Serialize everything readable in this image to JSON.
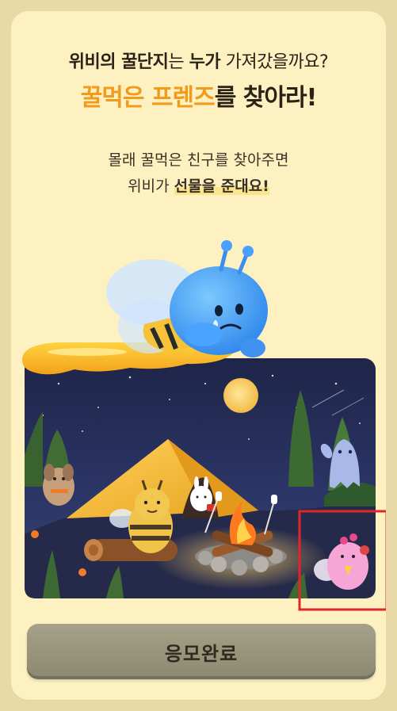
{
  "heading": {
    "line1_bold1": "위비의 꿀단지",
    "line1_light1": "는 ",
    "line1_bold2": "누가",
    "line1_light2": " 가져갔을까요?",
    "line2_orange": "꿀먹은 프렌즈",
    "line2_rest": "를 찾아라!"
  },
  "description": {
    "line1": "몰래 꿀먹은 친구를 찾아주면",
    "line2_prefix": "위비가 ",
    "line2_highlight": "선물을 준대요!"
  },
  "submit_button": {
    "label": "응모완료"
  },
  "colors": {
    "page_bg": "#e8d9a6",
    "card_bg": "#fdf1c2",
    "accent_orange": "#f39a1c",
    "highlight_marker": "#fbe58c",
    "button_disabled": "#9a9680",
    "found_box": "#e0252b"
  },
  "illustration": {
    "characters": [
      "bee-mascot-sad-icon",
      "bee-character-icon",
      "rabbit-in-tent-icon",
      "dog-character-icon",
      "ghost-character-icon",
      "pink-bird-character-icon"
    ],
    "objects": [
      "honey-drip-icon",
      "tent-icon",
      "campfire-icon",
      "moon-icon",
      "tree-icon",
      "log-icon"
    ]
  }
}
